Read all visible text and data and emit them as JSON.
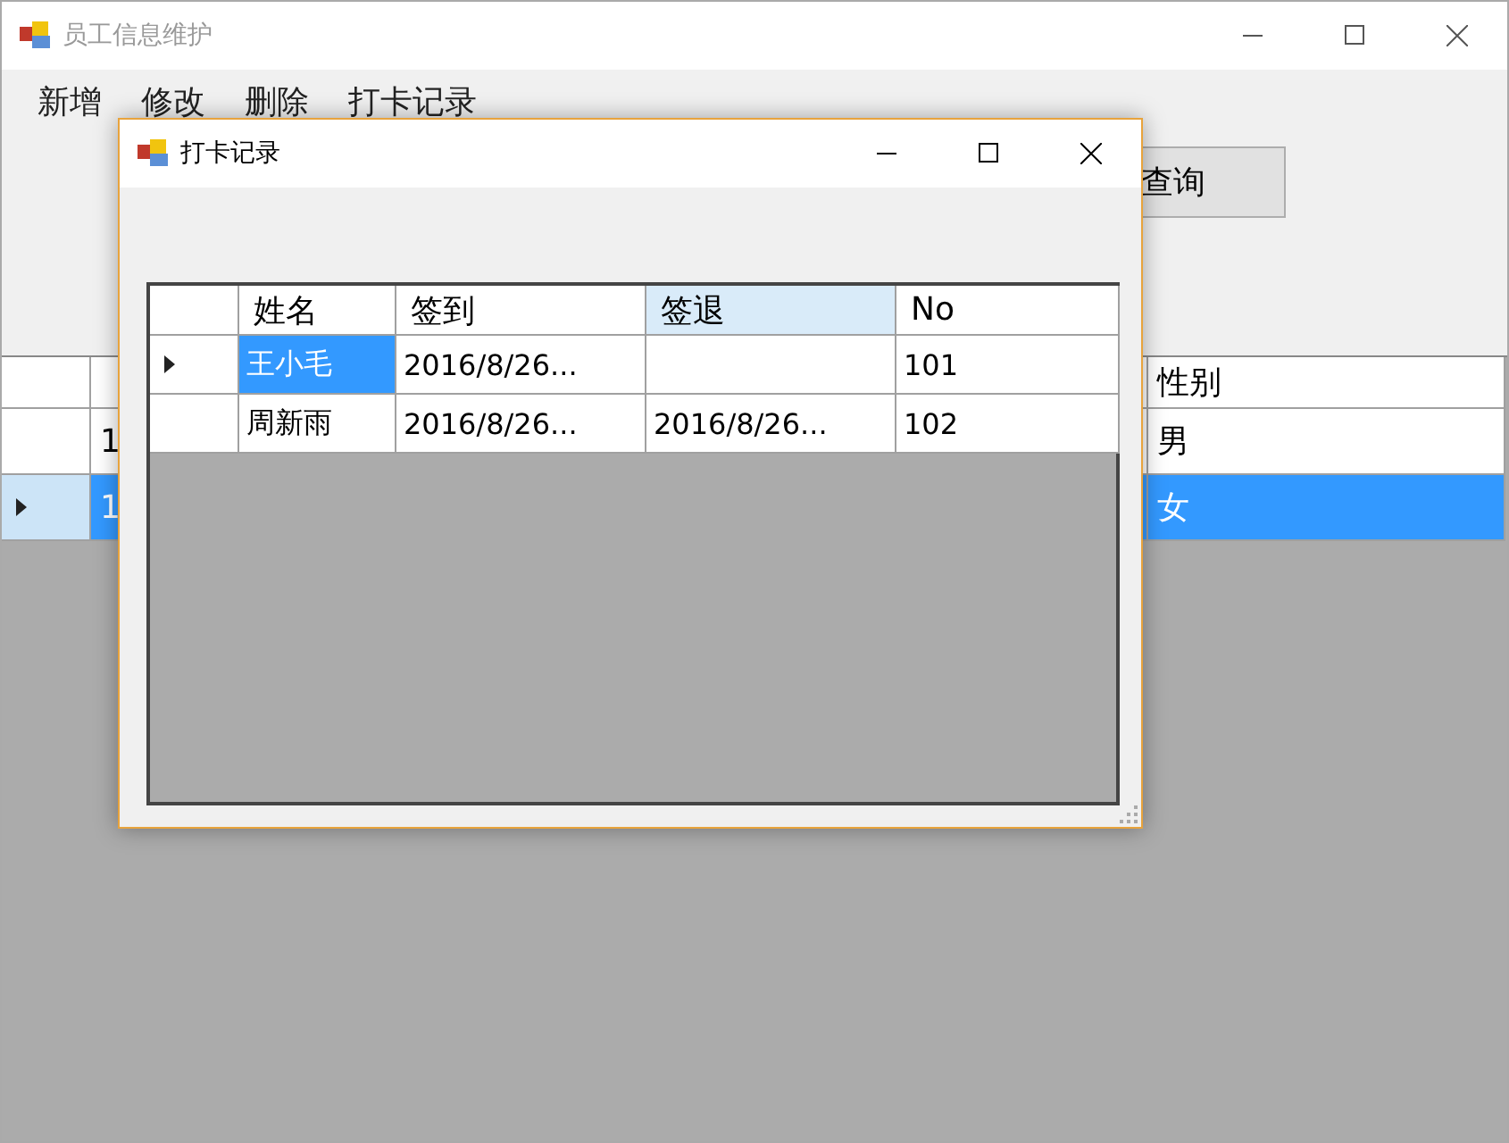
{
  "main_window": {
    "title": "员工信息维护",
    "menu": [
      {
        "label": "新增"
      },
      {
        "label": "修改"
      },
      {
        "label": "删除"
      },
      {
        "label": "打卡记录"
      }
    ],
    "query_button": "查询",
    "grid": {
      "column_header": "性别",
      "rows": [
        {
          "selected": false,
          "column_1": "1",
          "gender": "男"
        },
        {
          "selected": true,
          "column_1": "1",
          "gender": "女"
        }
      ]
    }
  },
  "dialog": {
    "title": "打卡记录",
    "columns": [
      {
        "label": "姓名",
        "selected": false
      },
      {
        "label": "签到",
        "selected": false
      },
      {
        "label": "签退",
        "selected": true
      },
      {
        "label": "No",
        "selected": false
      }
    ],
    "rows": [
      {
        "current": true,
        "cells": [
          {
            "text": "王小毛",
            "selected": true
          },
          {
            "text": "2016/8/26...",
            "selected": false
          },
          {
            "text": "",
            "selected": false
          },
          {
            "text": "101",
            "selected": false
          }
        ]
      },
      {
        "current": false,
        "cells": [
          {
            "text": "周新雨",
            "selected": false
          },
          {
            "text": "2016/8/26...",
            "selected": false
          },
          {
            "text": "2016/8/26...",
            "selected": false
          },
          {
            "text": "102",
            "selected": false
          }
        ]
      }
    ]
  }
}
